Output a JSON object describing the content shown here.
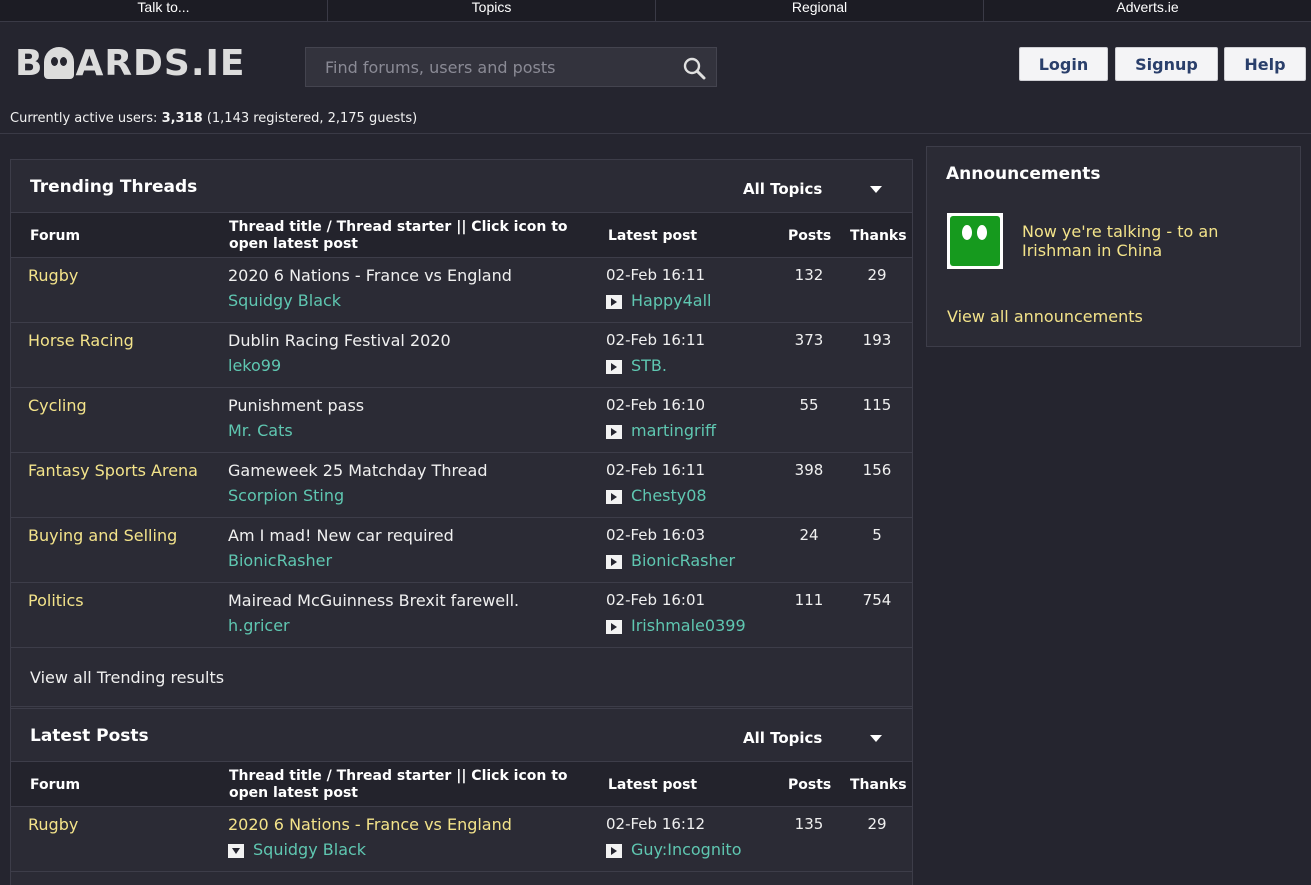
{
  "topnav": [
    "Talk to...",
    "Topics",
    "Regional",
    "Adverts.ie"
  ],
  "logo": "BOARDS.IE",
  "search": {
    "placeholder": "Find forums, users and posts"
  },
  "header_buttons": {
    "login": "Login",
    "signup": "Signup",
    "help": "Help"
  },
  "active_users": {
    "label": "Currently active users:",
    "count": "3,318",
    "detail": "(1,143 registered, 2,175 guests)"
  },
  "trending": {
    "title": "Trending Threads",
    "filter": "All Topics",
    "columns": {
      "forum": "Forum",
      "thread": "Thread title / Thread starter || Click icon to open latest post",
      "latest": "Latest post",
      "posts": "Posts",
      "thanks": "Thanks"
    },
    "rows": [
      {
        "forum": "Rugby",
        "title": "2020 6 Nations - France vs England",
        "starter": "Squidgy Black",
        "date": "02-Feb 16:11",
        "last_user": "Happy4all",
        "posts": "132",
        "thanks": "29"
      },
      {
        "forum": "Horse Racing",
        "title": "Dublin Racing Festival 2020",
        "starter": "leko99",
        "date": "02-Feb 16:11",
        "last_user": "STB.",
        "posts": "373",
        "thanks": "193"
      },
      {
        "forum": "Cycling",
        "title": "Punishment pass",
        "starter": "Mr. Cats",
        "date": "02-Feb 16:10",
        "last_user": "martingriff",
        "posts": "55",
        "thanks": "115"
      },
      {
        "forum": "Fantasy Sports Arena",
        "title": "Gameweek 25 Matchday Thread",
        "starter": "Scorpion Sting",
        "date": "02-Feb 16:11",
        "last_user": "Chesty08",
        "posts": "398",
        "thanks": "156"
      },
      {
        "forum": "Buying and Selling",
        "title": "Am I mad! New car required",
        "starter": "BionicRasher",
        "date": "02-Feb 16:03",
        "last_user": "BionicRasher",
        "posts": "24",
        "thanks": "5"
      },
      {
        "forum": "Politics",
        "title": "Mairead McGuinness Brexit farewell.",
        "starter": "h.gricer",
        "date": "02-Feb 16:01",
        "last_user": "Irishmale0399",
        "posts": "111",
        "thanks": "754"
      }
    ],
    "view_all": "View all Trending results"
  },
  "latest": {
    "title": "Latest Posts",
    "filter": "All Topics",
    "columns": {
      "forum": "Forum",
      "thread": "Thread title / Thread starter || Click icon to open latest post",
      "latest": "Latest post",
      "posts": "Posts",
      "thanks": "Thanks"
    },
    "rows": [
      {
        "forum": "Rugby",
        "title": "2020 6 Nations - France vs England",
        "starter": "Squidgy Black",
        "date": "02-Feb 16:12",
        "last_user": "Guy:Incognito",
        "posts": "135",
        "thanks": "29"
      }
    ]
  },
  "announcements": {
    "title": "Announcements",
    "item": "Now ye're talking - to an Irishman in China",
    "view_all": "View all announcements"
  }
}
